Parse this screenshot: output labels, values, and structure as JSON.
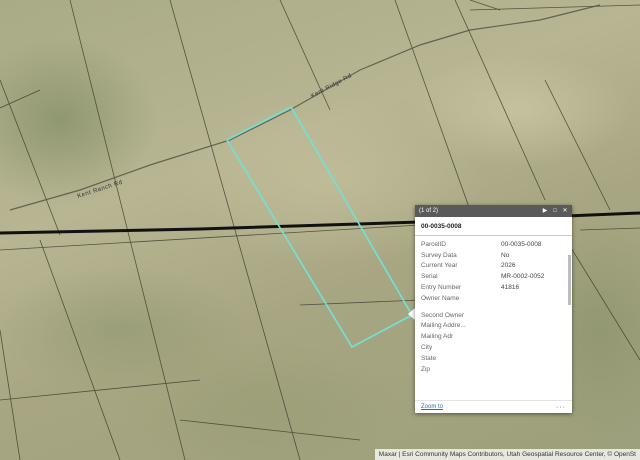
{
  "map": {
    "roads": [
      {
        "name": "Kent Ranch Rd"
      },
      {
        "name": "Kent Ridge Rd"
      }
    ],
    "attribution": "Maxar | Esri Community Maps Contributors, Utah Geospatial Resource Center, © OpenSt",
    "colors": {
      "parcel_highlight": "#6fe3d8",
      "boundary": "#111111",
      "parcel_lines": "#3a3a2a"
    }
  },
  "popup": {
    "counter": "(1 of 2)",
    "title": "00-0035-0008",
    "fields": [
      {
        "label": "ParcelID",
        "value": "00-0035-0008"
      },
      {
        "label": "Survey Data",
        "value": "No"
      },
      {
        "label": "Current Year",
        "value": "2026"
      },
      {
        "label": "Serial",
        "value": "MR-0002-0052"
      },
      {
        "label": "Entry Number",
        "value": "41816"
      },
      {
        "label": "Owner Name",
        "value": ""
      },
      {
        "label": "Second Owner",
        "value": ""
      },
      {
        "label": "Mailing Addre...",
        "value": ""
      },
      {
        "label": "Mailing Adr",
        "value": ""
      },
      {
        "label": "City",
        "value": ""
      },
      {
        "label": "State",
        "value": ""
      },
      {
        "label": "Zip",
        "value": ""
      }
    ],
    "zoom_label": "Zoom to",
    "more_label": "···",
    "icons": [
      "play-icon",
      "maximize-icon",
      "close-icon"
    ]
  }
}
